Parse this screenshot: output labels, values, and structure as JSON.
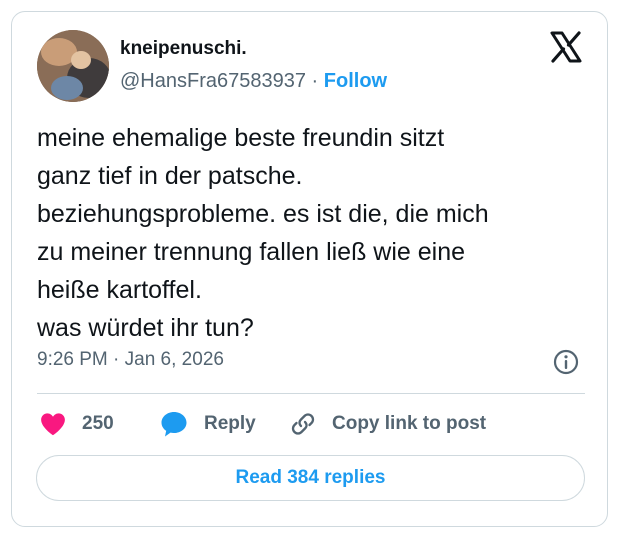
{
  "author": {
    "display_name": "kneipenuschi.",
    "handle": "@HansFra67583937",
    "separator": "·",
    "follow_label": "Follow",
    "avatar_icon": "profile-photo"
  },
  "tweet": {
    "lines": [
      "meine ehemalige beste freundin sitzt",
      "ganz tief in der patsche.",
      "beziehungsprobleme. es ist die, die mich",
      "zu meiner trennung fallen ließ wie eine",
      "heiße kartoffel.",
      "was würdet ihr tun?"
    ],
    "timestamp": "9:26 PM · Jan 6, 2026"
  },
  "actions": {
    "like_count": "250",
    "reply_label": "Reply",
    "copy_label": "Copy link to post",
    "read_replies_label": "Read 384 replies"
  },
  "icons": {
    "logo": "x-logo-icon",
    "info": "info-icon",
    "like": "heart-icon",
    "reply": "speech-bubble-icon",
    "copy": "link-icon"
  },
  "colors": {
    "accent": "#1d9bf0",
    "heart": "#f91880",
    "text": "#0f1419",
    "muted": "#536471",
    "border": "#cfd9de"
  }
}
